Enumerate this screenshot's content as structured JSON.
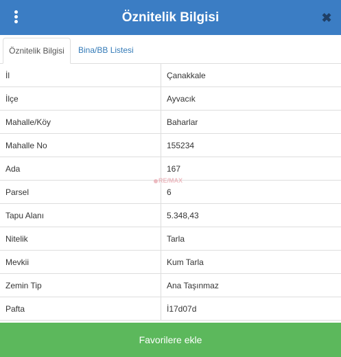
{
  "header": {
    "title": "Öznitelik Bilgisi",
    "menu_icon": "vertical-dots-icon",
    "close_icon": "close-icon",
    "close_glyph": "✖",
    "background_color": "#3b7dc4"
  },
  "tabs": [
    {
      "label": "Öznitelik Bilgisi",
      "active": true
    },
    {
      "label": "Bina/BB Listesi",
      "active": false
    }
  ],
  "attributes": [
    {
      "key": "İl",
      "value": "Çanakkale"
    },
    {
      "key": "İlçe",
      "value": "Ayvacık"
    },
    {
      "key": "Mahalle/Köy",
      "value": "Baharlar"
    },
    {
      "key": "Mahalle No",
      "value": "155234"
    },
    {
      "key": "Ada",
      "value": "167"
    },
    {
      "key": "Parsel",
      "value": "6"
    },
    {
      "key": "Tapu Alanı",
      "value": "5.348,43"
    },
    {
      "key": "Nitelik",
      "value": "Tarla"
    },
    {
      "key": "Mevkii",
      "value": "Kum Tarla"
    },
    {
      "key": "Zemin Tip",
      "value": "Ana Taşınmaz"
    },
    {
      "key": "Pafta",
      "value": "İ17d07d"
    }
  ],
  "watermark": "RE/MAX",
  "favorite_button": {
    "label": "Favorilere ekle",
    "color": "#5cb85c"
  }
}
